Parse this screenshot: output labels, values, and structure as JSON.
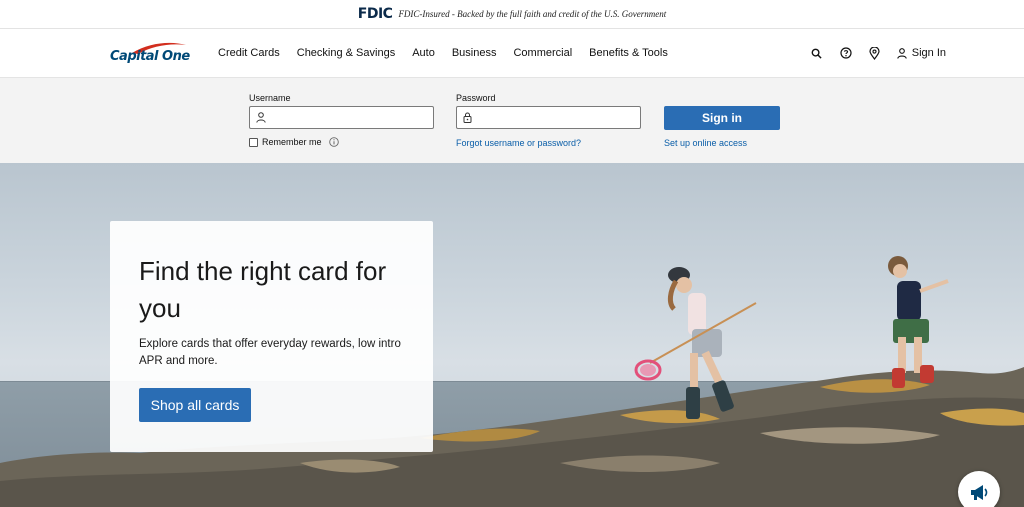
{
  "fdic": {
    "logo": "FDIC",
    "text": "FDIC-Insured - Backed by the full faith and credit of the U.S. Government"
  },
  "header": {
    "logo_text": "Capital One",
    "nav": [
      "Credit Cards",
      "Checking & Savings",
      "Auto",
      "Business",
      "Commercial",
      "Benefits & Tools"
    ],
    "icons": [
      "search-icon",
      "help-icon",
      "location-icon",
      "user-icon"
    ],
    "sign_in": "Sign In"
  },
  "login": {
    "username_label": "Username",
    "username_value": "",
    "password_label": "Password",
    "password_value": "",
    "remember_label": "Remember me",
    "remember_checked": false,
    "forgot_link": "Forgot username or password?",
    "signin_button": "Sign in",
    "setup_link": "Set up online access"
  },
  "hero": {
    "title": "Find the right card for you",
    "subtitle": "Explore cards that offer everyday rewards, low intro APR and more.",
    "cta": "Shop all cards"
  },
  "colors": {
    "brand_blue": "#004977",
    "button_blue": "#2a6db4",
    "link_blue": "#0a5ea8",
    "logo_red": "#d22e1e"
  }
}
